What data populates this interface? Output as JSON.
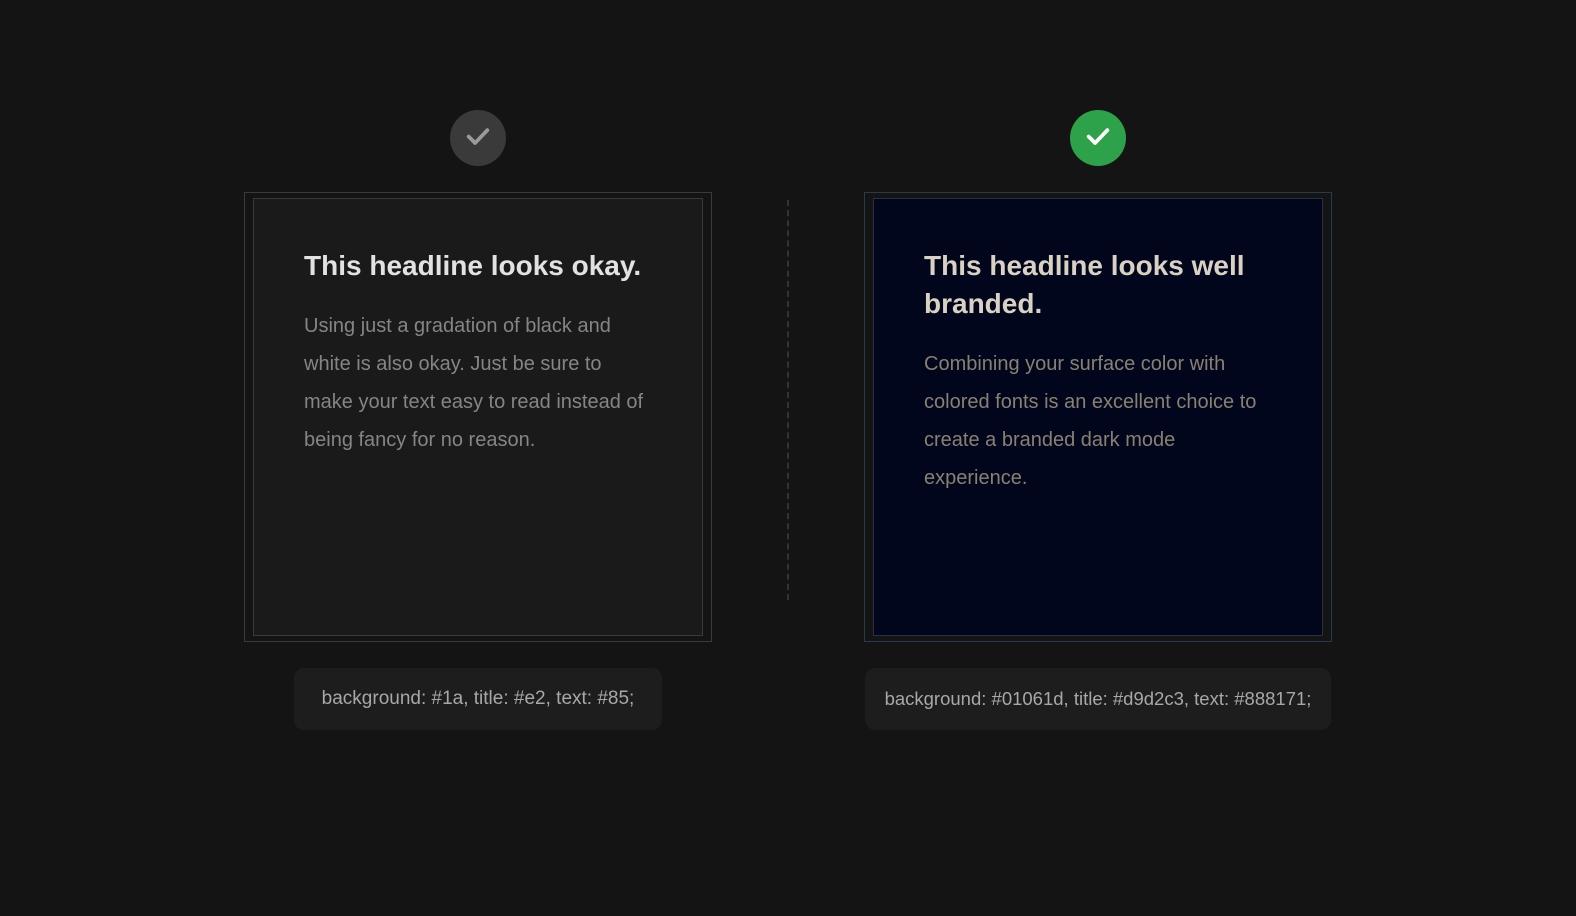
{
  "left": {
    "badge_status": "okay",
    "headline": "This headline looks okay.",
    "body": "Using just a gradation of black and white is also okay. Just be sure to make your text easy to read instead of being fancy for no reason.",
    "caption": "background: #1a, title: #e2, text: #85;",
    "colors": {
      "background": "#1a1a1a",
      "title": "#e2e2e2",
      "text": "#858585"
    }
  },
  "right": {
    "badge_status": "good",
    "headline": "This headline looks well branded.",
    "body": "Combining your surface color with colored fonts is an excellent choice to create a branded dark mode experience.",
    "caption": "background: #01061d, title: #d9d2c3, text: #888171;",
    "colors": {
      "background": "#01061d",
      "title": "#d9d2c3",
      "text": "#888171"
    }
  }
}
